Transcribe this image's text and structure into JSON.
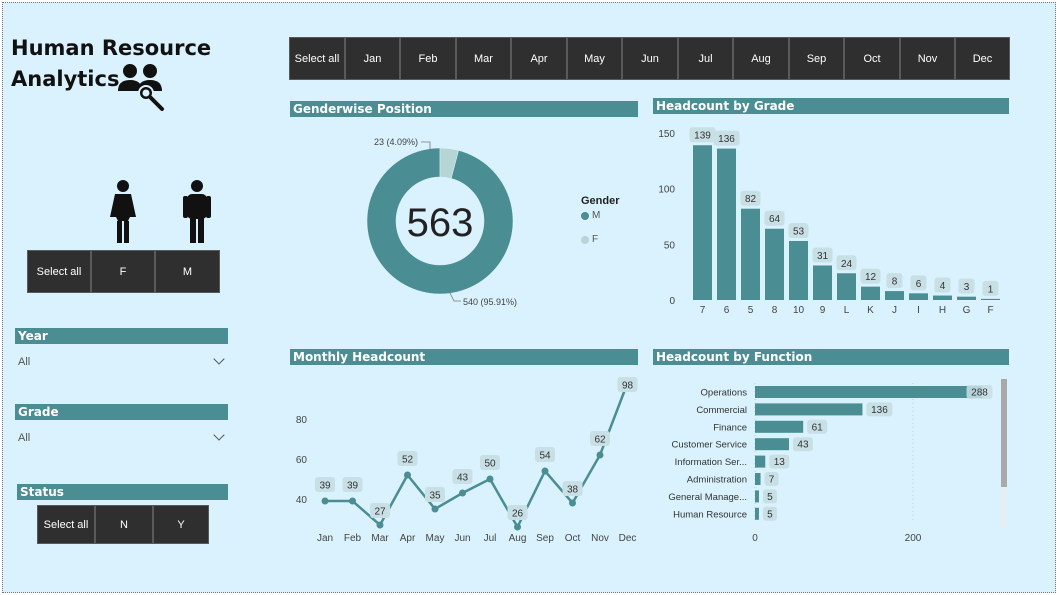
{
  "title_line1": "Human Resource",
  "title_line2": "Analytics",
  "months": [
    "Select all",
    "Jan",
    "Feb",
    "Mar",
    "Apr",
    "May",
    "Jun",
    "Jul",
    "Aug",
    "Sep",
    "Oct",
    "Nov",
    "Dec"
  ],
  "gender_buttons": [
    "Select all",
    "F",
    "M"
  ],
  "year_slicer": {
    "label": "Year",
    "value": "All"
  },
  "grade_slicer": {
    "label": "Grade",
    "value": "All"
  },
  "status_slicer": {
    "label": "Status",
    "buttons": [
      "Select all",
      "N",
      "Y"
    ]
  },
  "colors": {
    "teal": "#4a8d92",
    "light": "#b5d6d4",
    "bg": "#d9f2fd",
    "button": "#2f2f2f"
  },
  "chart_data": [
    {
      "type": "pie",
      "title": "Genderwise Position",
      "center_label": "563",
      "legend_title": "Gender",
      "legend": [
        "M",
        "F"
      ],
      "slices": [
        {
          "name": "M",
          "value": 540,
          "label": "540 (95.91%)"
        },
        {
          "name": "F",
          "value": 23,
          "label": "23 (4.09%)"
        }
      ]
    },
    {
      "type": "bar",
      "title": "Headcount by Grade",
      "categories": [
        "7",
        "6",
        "5",
        "8",
        "10",
        "9",
        "L",
        "K",
        "J",
        "I",
        "H",
        "G",
        "F"
      ],
      "values": [
        139,
        136,
        82,
        64,
        53,
        31,
        24,
        12,
        8,
        6,
        4,
        3,
        1
      ],
      "yticks": [
        0,
        50,
        100,
        150
      ],
      "ylim": [
        0,
        150
      ]
    },
    {
      "type": "line",
      "title": "Monthly Headcount",
      "categories": [
        "Jan",
        "Feb",
        "Mar",
        "Apr",
        "May",
        "Jun",
        "Jul",
        "Aug",
        "Sep",
        "Oct",
        "Nov",
        "Dec"
      ],
      "values": [
        39,
        39,
        27,
        52,
        35,
        43,
        50,
        26,
        54,
        38,
        62,
        98
      ],
      "yticks": [
        40,
        60,
        80
      ]
    },
    {
      "type": "bar",
      "orientation": "horizontal",
      "title": "Headcount by Function",
      "categories": [
        "Operations",
        "Commercial",
        "Finance",
        "Customer Service",
        "Information Ser...",
        "Administration",
        "General Manage...",
        "Human Resource"
      ],
      "values": [
        288,
        136,
        61,
        43,
        13,
        7,
        5,
        5
      ],
      "xticks": [
        0,
        200
      ]
    }
  ]
}
